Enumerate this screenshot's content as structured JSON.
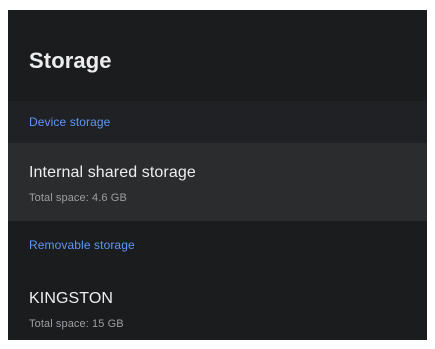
{
  "header": {
    "title": "Storage"
  },
  "sections": [
    {
      "label": "Device storage",
      "items": [
        {
          "title": "Internal shared storage",
          "subtitle": "Total space: 4.6 GB"
        }
      ]
    },
    {
      "label": "Removable storage",
      "items": [
        {
          "title": "KINGSTON",
          "subtitle": "Total space: 15 GB"
        }
      ]
    }
  ],
  "colors": {
    "background": "#1b1c1e",
    "section_header": "#5e97f6",
    "focused_item": "#2b2c2e",
    "title_text": "#eeeeee",
    "subtitle_text": "#9c9ea2"
  }
}
